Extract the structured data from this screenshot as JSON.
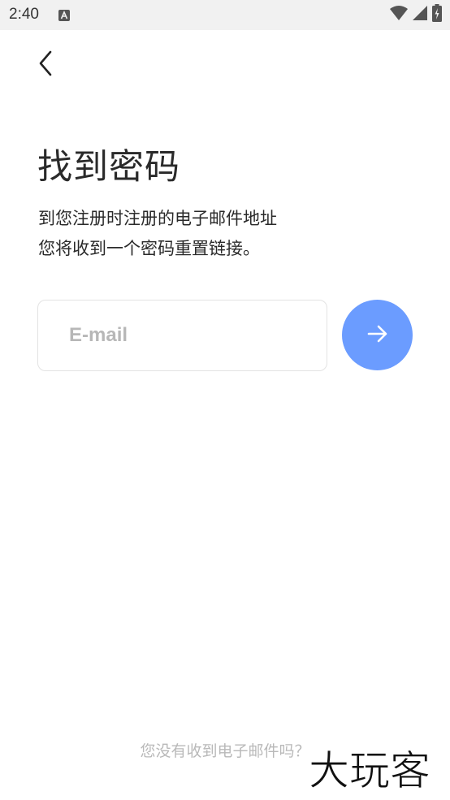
{
  "status_bar": {
    "time": "2:40"
  },
  "header": {
    "back_icon": "chevron-left-icon"
  },
  "main": {
    "title": "找到密码",
    "description_line1": "到您注册时注册的电子邮件地址",
    "description_line2": "您将收到一个密码重置链接。",
    "email_placeholder": "E-mail",
    "email_value": "",
    "submit_icon": "arrow-right-icon"
  },
  "footer": {
    "no_email_link": "您没有收到电子邮件吗？"
  },
  "watermark": {
    "text": "大玩客"
  },
  "colors": {
    "accent": "#6b9cff",
    "status_bar_bg": "#f1f1f1",
    "placeholder": "#b7b7b7",
    "link_text": "#b9b9b9"
  }
}
